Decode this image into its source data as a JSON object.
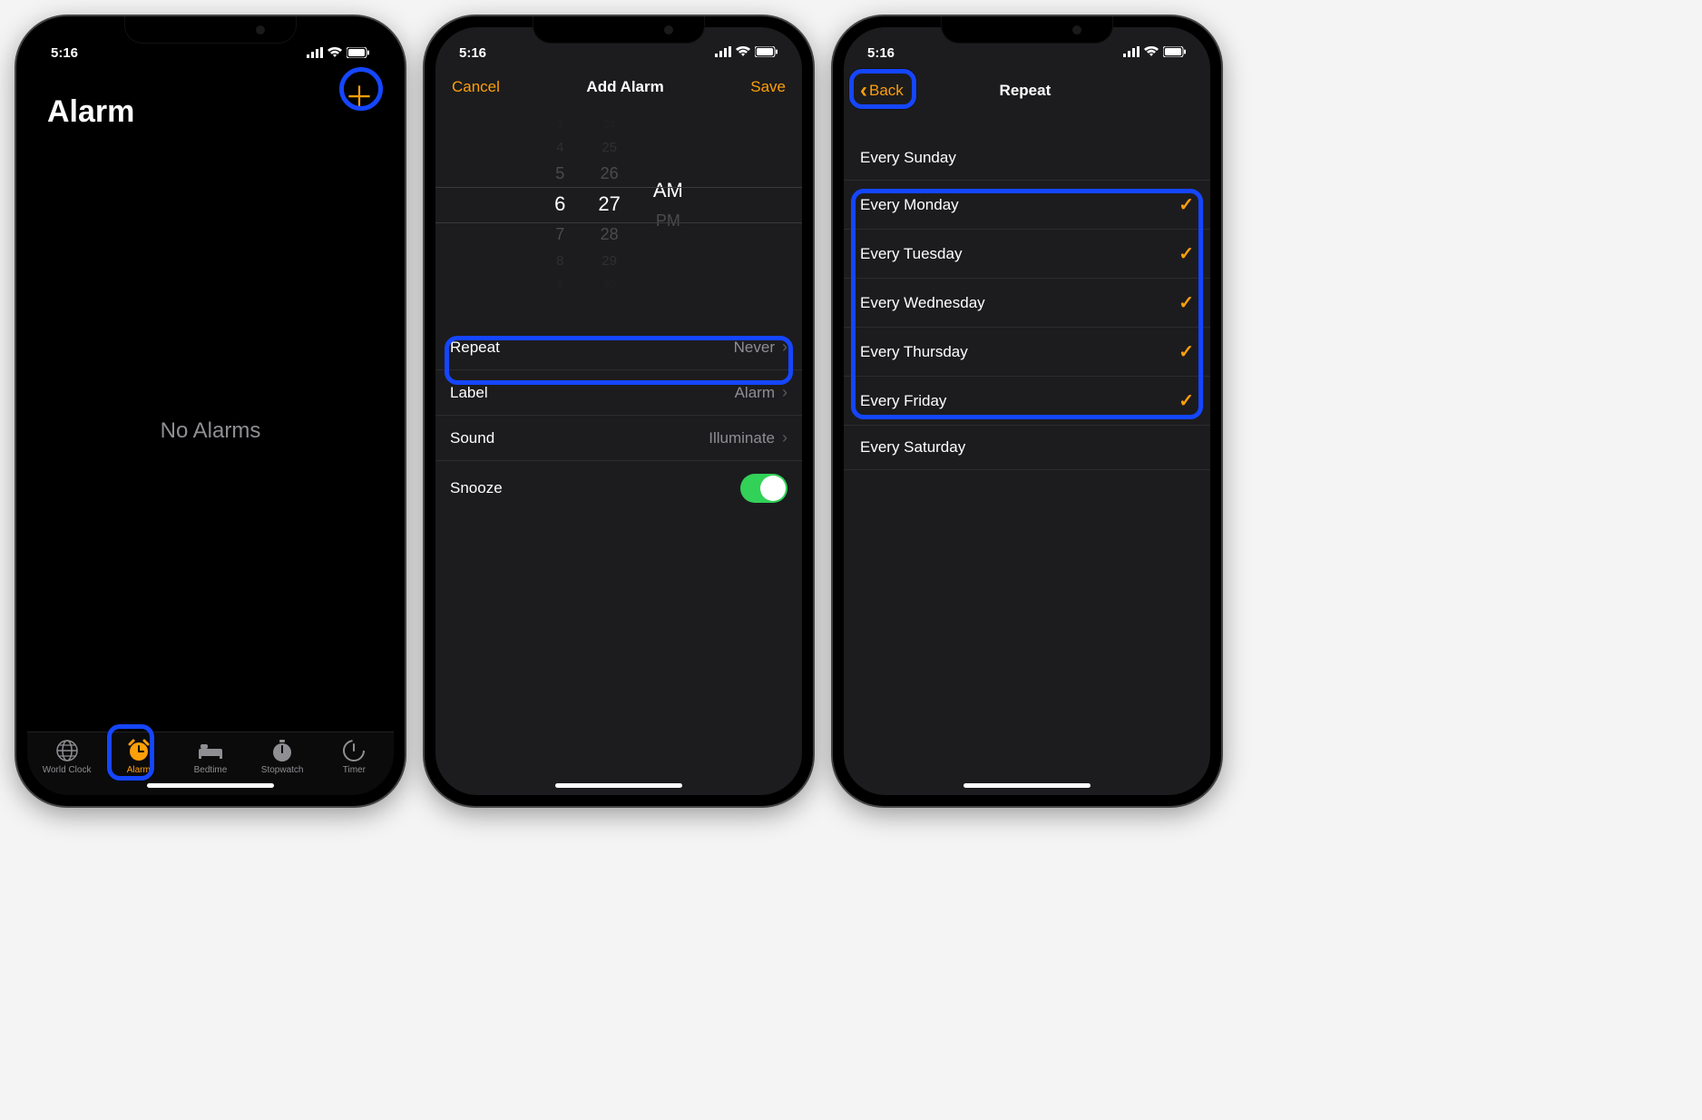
{
  "status": {
    "time": "5:16"
  },
  "screen1": {
    "title": "Alarm",
    "empty": "No Alarms",
    "tabs": {
      "world": "World Clock",
      "alarm": "Alarm",
      "bedtime": "Bedtime",
      "stopwatch": "Stopwatch",
      "timer": "Timer"
    }
  },
  "screen2": {
    "cancel": "Cancel",
    "title": "Add Alarm",
    "save": "Save",
    "picker": {
      "hours": [
        "3",
        "4",
        "5",
        "6",
        "7",
        "8",
        "9"
      ],
      "minutes": [
        "24",
        "25",
        "26",
        "27",
        "28",
        "29",
        "30"
      ],
      "ampm": [
        "AM",
        "PM"
      ]
    },
    "rows": {
      "repeat_label": "Repeat",
      "repeat_value": "Never",
      "label_label": "Label",
      "label_value": "Alarm",
      "sound_label": "Sound",
      "sound_value": "Illuminate",
      "snooze_label": "Snooze",
      "snooze_on": true
    }
  },
  "screen3": {
    "back": "Back",
    "title": "Repeat",
    "days": [
      {
        "label": "Every Sunday",
        "checked": false
      },
      {
        "label": "Every Monday",
        "checked": true
      },
      {
        "label": "Every Tuesday",
        "checked": true
      },
      {
        "label": "Every Wednesday",
        "checked": true
      },
      {
        "label": "Every Thursday",
        "checked": true
      },
      {
        "label": "Every Friday",
        "checked": true
      },
      {
        "label": "Every Saturday",
        "checked": false
      }
    ]
  }
}
